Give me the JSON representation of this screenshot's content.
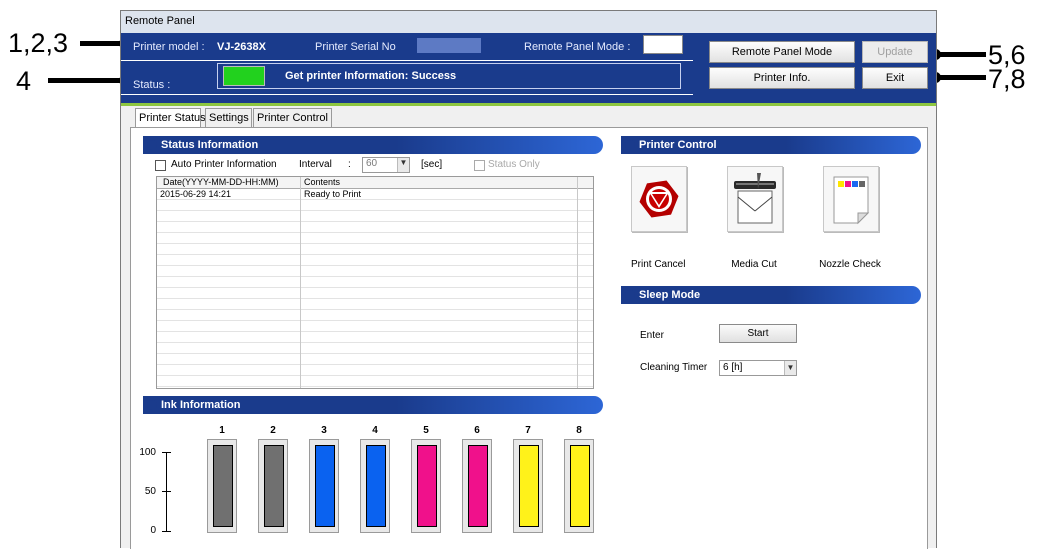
{
  "callouts": {
    "c123": "1,2,3",
    "c4": "4",
    "c56": "5,6",
    "c78": "7,8"
  },
  "window": {
    "title": "Remote Panel"
  },
  "header": {
    "model_label": "Printer model :",
    "model_value": "VJ-2638X",
    "serial_label": "Printer Serial No",
    "mode_label": "Remote Panel Mode :",
    "status_label": "Status :",
    "status_text": "Get printer Information: Success",
    "status_color": "#22d11e",
    "btn_mode": "Remote Panel Mode",
    "btn_update": "Update",
    "btn_info": "Printer Info.",
    "btn_exit": "Exit"
  },
  "tabs": [
    "Printer Status",
    "Settings",
    "Printer Control"
  ],
  "status_info": {
    "title": "Status Information",
    "auto_label": "Auto Printer Information",
    "interval_label": "Interval",
    "interval_colon": ":",
    "interval_value": "60",
    "sec_label": "[sec]",
    "status_only_label": "Status Only",
    "col_date": "Date(YYYY-MM-DD-HH:MM)",
    "col_contents": "Contents",
    "rows": [
      {
        "date": "2015-06-29 14:21",
        "contents": "Ready to Print"
      }
    ]
  },
  "printer_control": {
    "title": "Printer Control",
    "cancel_label": "Print Cancel",
    "cut_label": "Media Cut",
    "nozzle_label": "Nozzle Check"
  },
  "sleep_mode": {
    "title": "Sleep Mode",
    "enter_label": "Enter",
    "start_label": "Start",
    "timer_label": "Cleaning Timer",
    "timer_value": "6  [h]"
  },
  "ink": {
    "title": "Ink Information",
    "axis_ticks": [
      "100",
      "50",
      "0"
    ],
    "tanks": [
      {
        "num": "1",
        "color": "#707070",
        "level": 1.0
      },
      {
        "num": "2",
        "color": "#707070",
        "level": 1.0
      },
      {
        "num": "3",
        "color": "#0a62f0",
        "level": 1.0
      },
      {
        "num": "4",
        "color": "#0a62f0",
        "level": 1.0
      },
      {
        "num": "5",
        "color": "#f0118b",
        "level": 1.0
      },
      {
        "num": "6",
        "color": "#f0118b",
        "level": 1.0
      },
      {
        "num": "7",
        "color": "#fff21a",
        "level": 1.0
      },
      {
        "num": "8",
        "color": "#fff21a",
        "level": 1.0
      }
    ]
  }
}
